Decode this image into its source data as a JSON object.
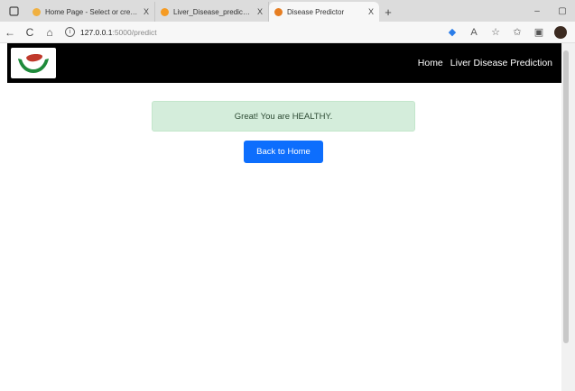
{
  "browser": {
    "tabs": [
      {
        "title": "Home Page - Select or create a",
        "favicon_color": "#f0b040",
        "active": false
      },
      {
        "title": "Liver_Disease_prediction - Jupyte",
        "favicon_color": "#f59b23",
        "active": false
      },
      {
        "title": "Disease Predictor",
        "favicon_color": "#e67e22",
        "active": true
      }
    ],
    "tab_close": "X",
    "new_tab": "+",
    "window_controls": {
      "minimize": "–",
      "restore": "▢"
    },
    "nav": {
      "back": "←",
      "refresh": "C",
      "home": "⌂"
    },
    "url": {
      "host": "127.0.0.1",
      "path": ":5000/predict"
    }
  },
  "page": {
    "navbar": {
      "links": [
        "Home",
        "Liver Disease Prediction"
      ]
    },
    "alert_text": "Great! You are HEALTHY.",
    "back_button": "Back to Home"
  },
  "colors": {
    "navbar_bg": "#000000",
    "alert_bg": "#d4eddb",
    "button_bg": "#0d6efd"
  }
}
